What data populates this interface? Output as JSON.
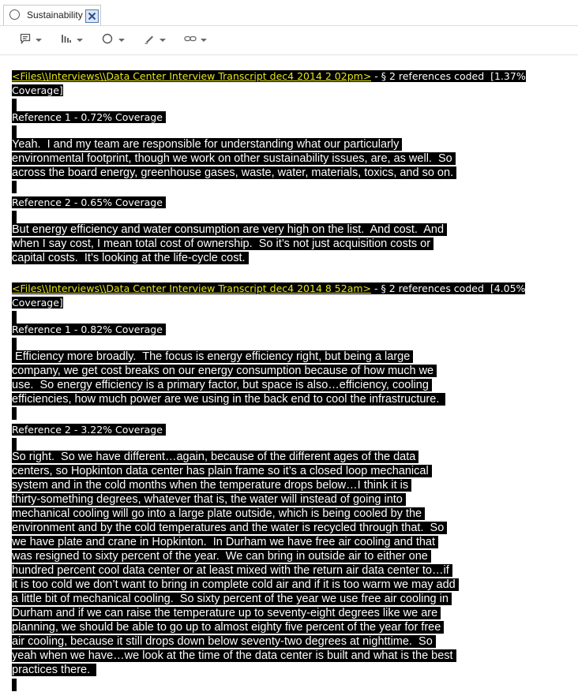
{
  "tab": {
    "title": "Sustainability"
  },
  "toolbar": {
    "icons": [
      "memo-icon",
      "chart-icon",
      "circle-icon",
      "highlight-icon",
      "link-icon"
    ]
  },
  "sources": [
    {
      "link": "<Files\\\\Interviews\\\\Data Center Interview Transcript dec4 2014 2 02pm>",
      "summary_line1": " - § 2 references coded  [1.37%",
      "summary_line2": "Coverage]",
      "references": [
        {
          "label": "Reference 1 - 0.72% Coverage ",
          "lines": [
            "Yeah.  I and my team are responsible for understanding what our particularly ",
            "environmental footprint, though we work on other sustainability issues, are, as well.  So ",
            "across the board energy, greenhouse gases, waste, water, materials, toxics, and so on. "
          ]
        },
        {
          "label": "Reference 2 - 0.65% Coverage ",
          "lines": [
            "But energy efficiency and water consumption are very high on the list.  And cost.  And ",
            "when I say cost, I mean total cost of ownership.  So it’s not just acquisition costs or ",
            "capital costs.  It’s looking at the life-cycle cost. "
          ]
        }
      ]
    },
    {
      "link": "<Files\\\\Interviews\\\\Data Center Interview Transcript dec4 2014 8 52am>",
      "summary_line1": " - § 2 references coded  [4.05%",
      "summary_line2": "Coverage]",
      "references": [
        {
          "label": "Reference 1 - 0.82% Coverage ",
          "lines": [
            " Efficiency more broadly.  The focus is energy efficiency right, but being a large ",
            "company, we get cost breaks on our energy consumption because of how much we ",
            "use.  So energy efficiency is a primary factor, but space is also…efficiency, cooling ",
            "efficiencies, how much power are we using in the back end to cool the infrastructure.  "
          ]
        },
        {
          "label": "Reference 2 - 3.22% Coverage ",
          "lines": [
            "So right.  So we have different…again, because of the different ages of the data ",
            "centers, so Hopkinton data center has plain frame so it’s a closed loop mechanical ",
            "system and in the cold months when the temperature drops below…I think it is ",
            "thirty-something degrees, whatever that is, the water will instead of going into ",
            "mechanical cooling will go into a large plate outside, which is being cooled by the ",
            "environment and by the cold temperatures and the water is recycled through that.  So ",
            "we have plate and crane in Hopkinton.  In Durham we have free air cooling and that ",
            "was resigned to sixty percent of the year.  We can bring in outside air to either one ",
            "hundred percent cool data center or at least mixed with the return air data center to…if ",
            "it is too cold we don’t want to bring in complete cold air and if it is too warm we may add ",
            "a little bit of mechanical cooling.  So sixty percent of the year we use free air cooling in ",
            "Durham and if we can raise the temperature up to seventy-eight degrees like we are ",
            "planning, we should be able to go up to almost eighty five percent of the year for free ",
            "air cooling, because it still drops down below seventy-two degrees at nighttime.  So ",
            "yeah when we have…we look at the time of the data center is built and what is the best ",
            "practices there.  "
          ]
        }
      ]
    }
  ]
}
